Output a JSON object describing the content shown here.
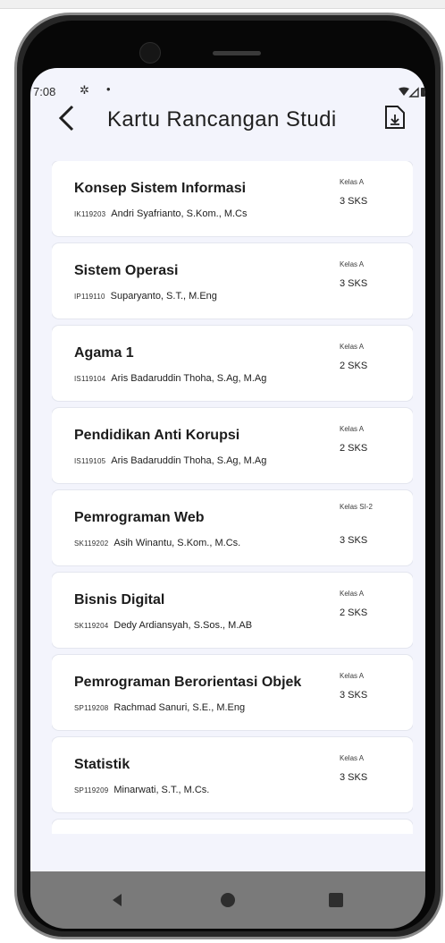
{
  "status_bar": {
    "time": "7:08",
    "gear_icon": "gear-icon",
    "dot": "•",
    "wifi_icon": "wifi-icon",
    "signal_icon": "signal-icon",
    "battery_icon": "battery-icon"
  },
  "header": {
    "back_icon": "chevron-left-icon",
    "title": "Kartu Rancangan Studi",
    "action_icon": "document-download-icon"
  },
  "courses": [
    {
      "name": "Konsep Sistem Informasi",
      "code": "IK119203",
      "lecturer": "Andri Syafrianto, S.Kom., M.Cs",
      "class": "Kelas A",
      "sks": "3 SKS"
    },
    {
      "name": "Sistem Operasi",
      "code": "IP119110",
      "lecturer": "Suparyanto, S.T., M.Eng",
      "class": "Kelas A",
      "sks": "3 SKS"
    },
    {
      "name": "Agama 1",
      "code": "IS119104",
      "lecturer": "Aris Badaruddin Thoha, S.Ag, M.Ag",
      "class": "Kelas A",
      "sks": "2 SKS"
    },
    {
      "name": "Pendidikan Anti Korupsi",
      "code": "IS119105",
      "lecturer": "Aris Badaruddin Thoha, S.Ag, M.Ag",
      "class": "Kelas A",
      "sks": "2 SKS"
    },
    {
      "name": "Pemrograman Web",
      "code": "SK119202",
      "lecturer": "Asih Winantu, S.Kom., M.Cs.",
      "class": "Kelas SI-2",
      "sks": "3 SKS"
    },
    {
      "name": "Bisnis Digital",
      "code": "SK119204",
      "lecturer": "Dedy Ardiansyah, S.Sos., M.AB",
      "class": "Kelas A",
      "sks": "2 SKS"
    },
    {
      "name": "Pemrograman Berorientasi Objek",
      "code": "SP119208",
      "lecturer": "Rachmad Sanuri, S.E., M.Eng",
      "class": "Kelas A",
      "sks": "3 SKS"
    },
    {
      "name": "Statistik",
      "code": "SP119209",
      "lecturer": "Minarwati, S.T., M.Cs.",
      "class": "Kelas A",
      "sks": "3 SKS"
    }
  ],
  "nav_bar": {
    "back_icon": "triangle-back-icon",
    "home_icon": "circle-home-icon",
    "recents_icon": "square-recents-icon",
    "color": "#7a7a7a"
  },
  "colors": {
    "screen_bg": "#f3f4fc",
    "card_bg": "#ffffff",
    "text": "#1c1c1c"
  }
}
